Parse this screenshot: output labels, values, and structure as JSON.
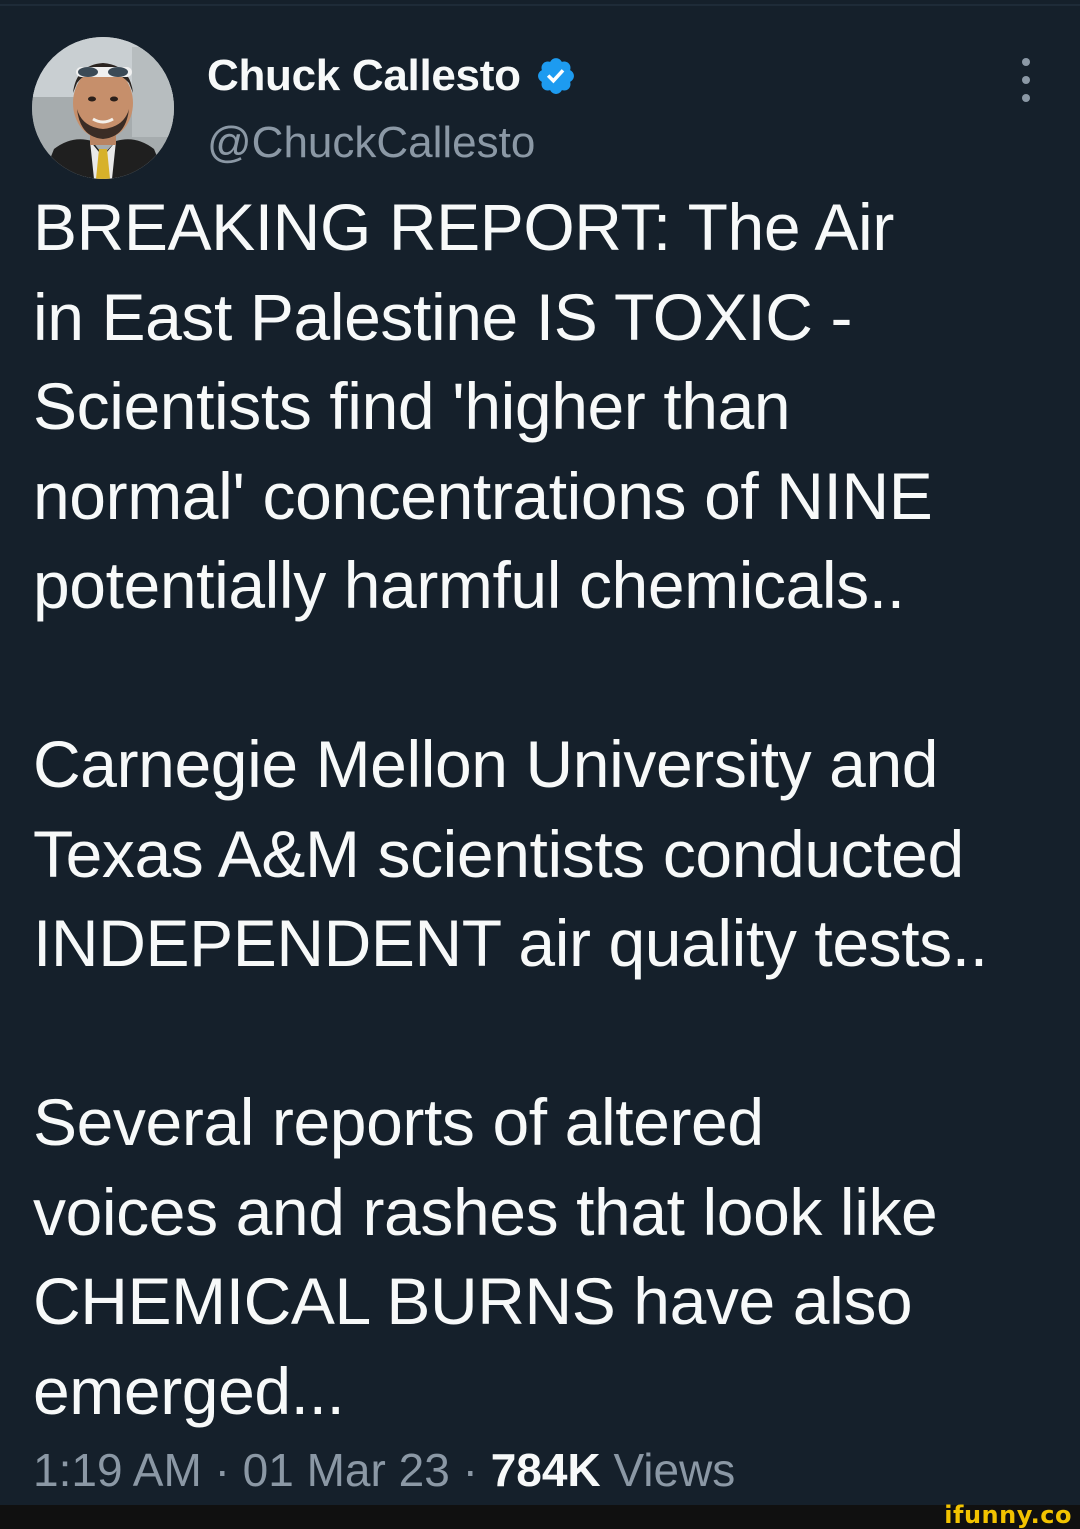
{
  "author": {
    "display_name": "Chuck Callesto",
    "handle": "@ChuckCallesto",
    "verified": true,
    "verified_color": "#1d9bf0"
  },
  "tweet": {
    "paragraphs": [
      "BREAKING REPORT: The Air\nin East Palestine IS TOXIC -\nScientists find  'higher than\nnormal' concentrations of NINE\npotentially harmful chemicals..",
      "Carnegie Mellon University and\nTexas A&M scientists conducted\nINDEPENDENT air quality tests..",
      "Several reports of altered\nvoices and rashes that look like\nCHEMICAL BURNS have also\nemerged..."
    ]
  },
  "meta": {
    "time": "1:19 AM",
    "separator": "·",
    "date": "01 Mar 23",
    "views_count": "784K",
    "views_label": "Views"
  },
  "watermark": "ifunny.co",
  "colors": {
    "background": "#15202b",
    "text": "#f7f9f9",
    "secondary": "#8b98a5"
  }
}
